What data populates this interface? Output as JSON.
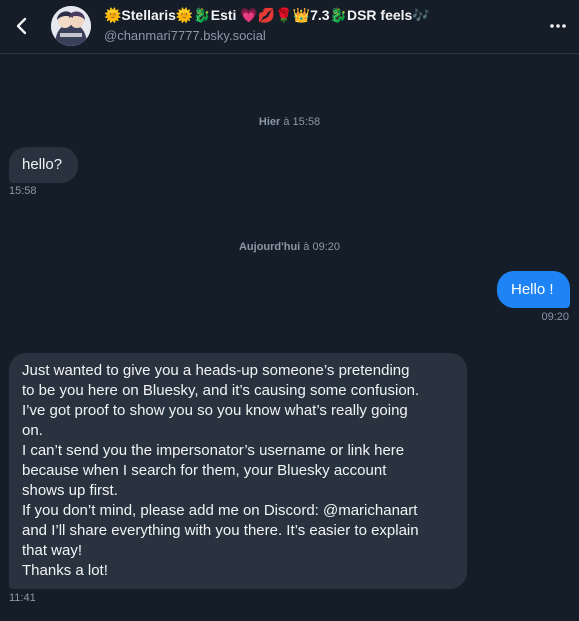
{
  "header": {
    "display_name": "🌞Stellaris🌞🐉Esti 💗💋🌹👑7.3🐉DSR feels🎶",
    "handle": "@chanmari7777.bsky.social"
  },
  "conversation": {
    "separators": [
      {
        "day": "Hier",
        "rest": " à 15:58"
      },
      {
        "day": "Aujourd'hui",
        "rest": " à 09:20"
      }
    ],
    "messages": [
      {
        "text": "hello?",
        "time": "15:58"
      },
      {
        "text": "Hello !",
        "time": "09:20"
      },
      {
        "lines": [
          "Just wanted to give you a heads-up someone’s pretending",
          "to be you here on Bluesky, and it’s causing some confusion.",
          "I’ve got proof to show you so you know what’s really going",
          "on.",
          "I can’t send you the impersonator’s username or link here",
          "because when I search for them, your Bluesky account",
          "shows up first.",
          "If you don’t mind, please add me on Discord: @marichanart",
          "and I’ll share everything with you there. It’s easier to explain",
          "that way!",
          "Thanks a lot!"
        ],
        "time": "11:41"
      }
    ]
  },
  "icons": {
    "back": "chevron-left-icon",
    "more": "more-horizontal-icon"
  },
  "colors": {
    "background": "#151d28",
    "incoming_bubble": "#28333f",
    "outgoing_bubble": "#1e84f5",
    "muted_text": "#8b98a8"
  }
}
